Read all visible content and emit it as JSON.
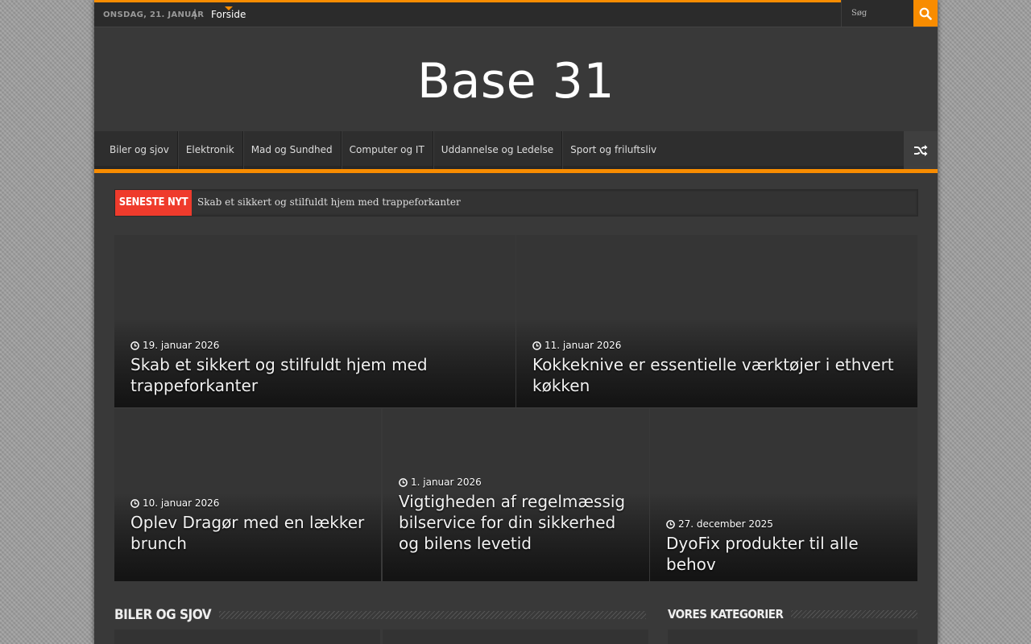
{
  "topbar": {
    "date": "ONSDAG, 21. JANUAR",
    "separator": "|",
    "home_link": "Forside",
    "search_placeholder": "Søg"
  },
  "site": {
    "title": "Base 31"
  },
  "nav": {
    "items": [
      "Biler og sjov",
      "Elektronik",
      "Mad og Sundhed",
      "Computer og IT",
      "Uddannelse og Ledelse",
      "Sport og friluftsliv"
    ]
  },
  "ticker": {
    "label": "Seneste nyt",
    "headline": "Skab et sikkert og stilfuldt hjem med trappeforkanter"
  },
  "posts": [
    {
      "date": "19. januar 2026",
      "title": "Skab et sikkert og stilfuldt hjem med trappeforkanter"
    },
    {
      "date": "11. januar 2026",
      "title": "Kokkeknive er essentielle værktøjer i ethvert køkken"
    },
    {
      "date": "10. januar 2026",
      "title": "Oplev Dragør med en lækker brunch"
    },
    {
      "date": "1. januar 2026",
      "title": "Vigtigheden af regelmæssig bilservice for din sikkerhed og bilens levetid"
    },
    {
      "date": "27. december 2025",
      "title": "DyoFix produkter til alle behov"
    }
  ],
  "sections": {
    "left_title": "Biler og sjov",
    "right_title": "Vores kategorier"
  },
  "colors": {
    "accent": "#f88c00",
    "ticker_label": "#ef3b2c"
  }
}
